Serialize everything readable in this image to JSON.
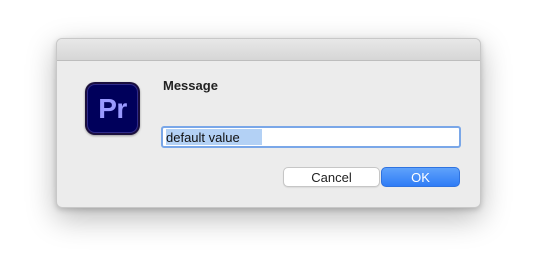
{
  "dialog": {
    "app_icon_label": "Pr",
    "app_icon_name": "adobe-premiere-pro-icon",
    "message": "Message",
    "input_value": "default value",
    "input_text_selected": true,
    "cancel_label": "Cancel",
    "ok_label": "OK"
  },
  "colors": {
    "icon_background": "#00005b",
    "icon_text": "#9999ff",
    "ok_button": "#3b86f7",
    "focus_ring": "#7aa7e8",
    "selection": "#b3d1f5"
  }
}
